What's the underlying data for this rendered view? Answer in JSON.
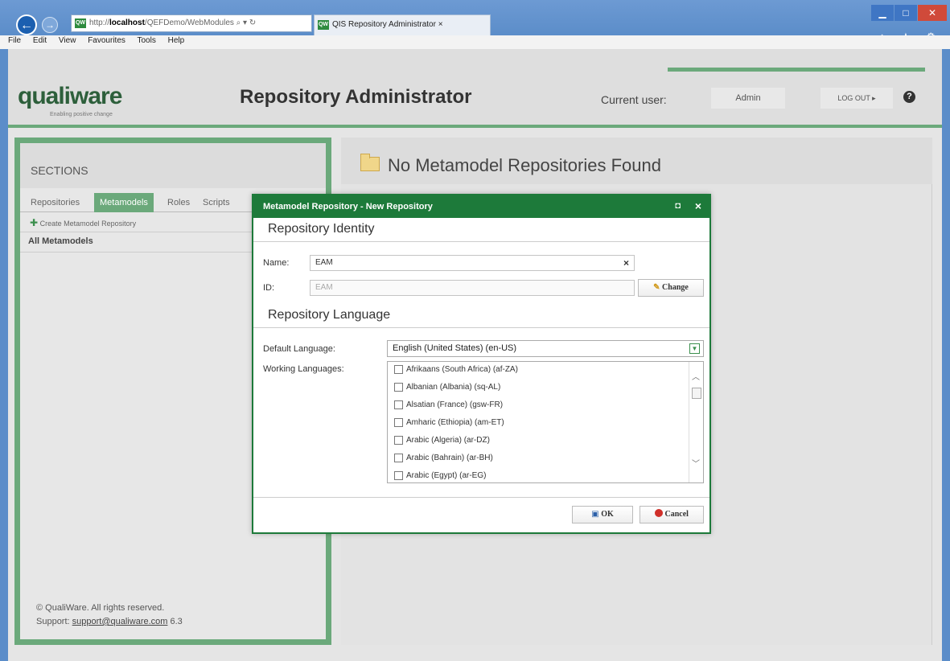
{
  "browser": {
    "url_prefix": "http://",
    "url_host": "localhost",
    "url_path": "/QEFDemo/WebModules",
    "url_controls": "⌕ ▾ ↻",
    "tab_title": "QIS Repository Administrator",
    "tab_close": "×",
    "favicon_label": "QW",
    "menu": [
      "File",
      "Edit",
      "View",
      "Favourites",
      "Tools",
      "Help"
    ],
    "window_min": "▁",
    "window_max": "□",
    "window_close": "✕",
    "toolbar_icons": "⌂ ★ ⚙"
  },
  "header": {
    "logo": "qualiware",
    "tagline": "Enabling positive change",
    "title": "Repository Administrator",
    "current_user_label": "Current user:",
    "current_user": "Admin",
    "logout": "LOG OUT ▸",
    "help": "?"
  },
  "sidebar": {
    "title": "SECTIONS",
    "tabs": [
      "Repositories",
      "Metamodels",
      "Roles",
      "Scripts"
    ],
    "active_tab": 1,
    "create_link": "Create Metamodel Repository",
    "all_label": "All Metamodels",
    "footer_copyright": "© QualiWare. All rights reserved.",
    "footer_support_label": "Support:",
    "footer_support_email": "support@qualiware.com",
    "footer_version": "6.3"
  },
  "main": {
    "title": "No Metamodel Repositories Found"
  },
  "dialog": {
    "title": "Metamodel Repository - New Repository",
    "maximize": "◘",
    "close": "×",
    "identity_title": "Repository Identity",
    "name_label": "Name:",
    "name_value": "EAM",
    "clear": "×",
    "id_label": "ID:",
    "id_value": "EAM",
    "change_label": "Change",
    "language_title": "Repository Language",
    "default_language_label": "Default Language:",
    "default_language_value": "English (United States) (en-US)",
    "working_languages_label": "Working Languages:",
    "languages": [
      "Afrikaans (South Africa) (af-ZA)",
      "Albanian (Albania) (sq-AL)",
      "Alsatian (France) (gsw-FR)",
      "Amharic (Ethiopia) (am-ET)",
      "Arabic (Algeria) (ar-DZ)",
      "Arabic (Bahrain) (ar-BH)",
      "Arabic (Egypt) (ar-EG)"
    ],
    "ok_label": "OK",
    "cancel_label": "Cancel"
  }
}
